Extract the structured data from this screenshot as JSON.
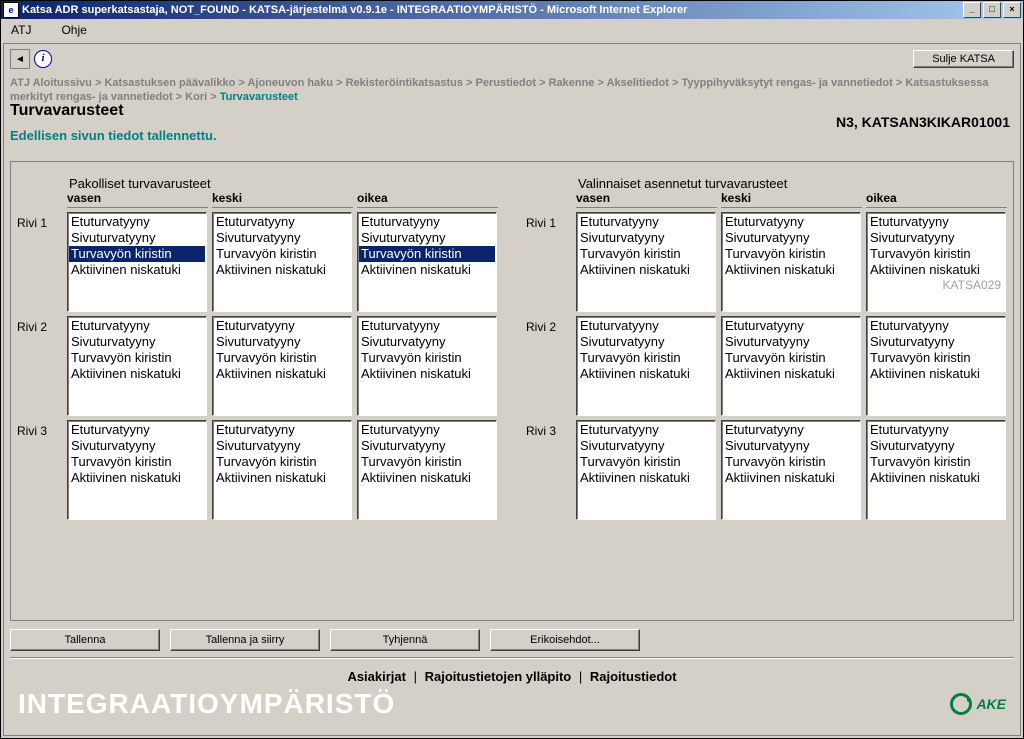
{
  "window": {
    "title": "Katsa ADR superkatsastaja, NOT_FOUND - KATSA-järjestelmä v0.9.1e - INTEGRAATIOYMPÄRISTÖ - Microsoft Internet Explorer"
  },
  "menu": {
    "atj": "ATJ",
    "ohje": "Ohje"
  },
  "toolbar": {
    "back": "◄",
    "info": "i",
    "close": "Sulje KATSA"
  },
  "breadcrumb": {
    "items": [
      "ATJ Aloitussivu",
      "Katsastuksen päävalikko",
      "Ajoneuvon haku",
      "Rekisteröintikatsastus",
      "Perustiedot",
      "Rakenne",
      "Akselitiedot",
      "Tyyppihyväksytyt rengas- ja vannetiedot",
      "Katsastuksessa merkityt rengas- ja vannetiedot",
      "Kori"
    ],
    "current": "Turvavarusteet",
    "sep": " > "
  },
  "page": {
    "title": "Turvavarusteet",
    "vehicle": "N3, KATSAN3KIKAR01001",
    "saved": "Edellisen sivun tiedot tallennettu.",
    "code": "KATSA029"
  },
  "groups": {
    "mandatory": "Pakolliset turvavarusteet",
    "optional": "Valinnaiset asennetut turvavarusteet"
  },
  "columns": {
    "left": "vasen",
    "middle": "keski",
    "right": "oikea"
  },
  "rows": {
    "r1": "Rivi 1",
    "r2": "Rivi 2",
    "r3": "Rivi 3"
  },
  "options": {
    "o1": "Etuturvatyyny",
    "o2": "Sivuturvatyyny",
    "o3": "Turvavyön kiristin",
    "o4": "Aktiivinen niskatuki"
  },
  "selected": {
    "mandatory_r1_left": "o3",
    "mandatory_r1_right": "o3"
  },
  "buttons": {
    "save": "Tallenna",
    "savego": "Tallenna ja siirry",
    "clear": "Tyhjennä",
    "special": "Erikoisehdot..."
  },
  "links": {
    "docs": "Asiakirjat",
    "maint": "Rajoitustietojen ylläpito",
    "restr": "Rajoitustiedot",
    "sep": "|"
  },
  "footer": {
    "env": "INTEGRAATIOYMPÄRISTÖ",
    "logo": "AKE"
  }
}
